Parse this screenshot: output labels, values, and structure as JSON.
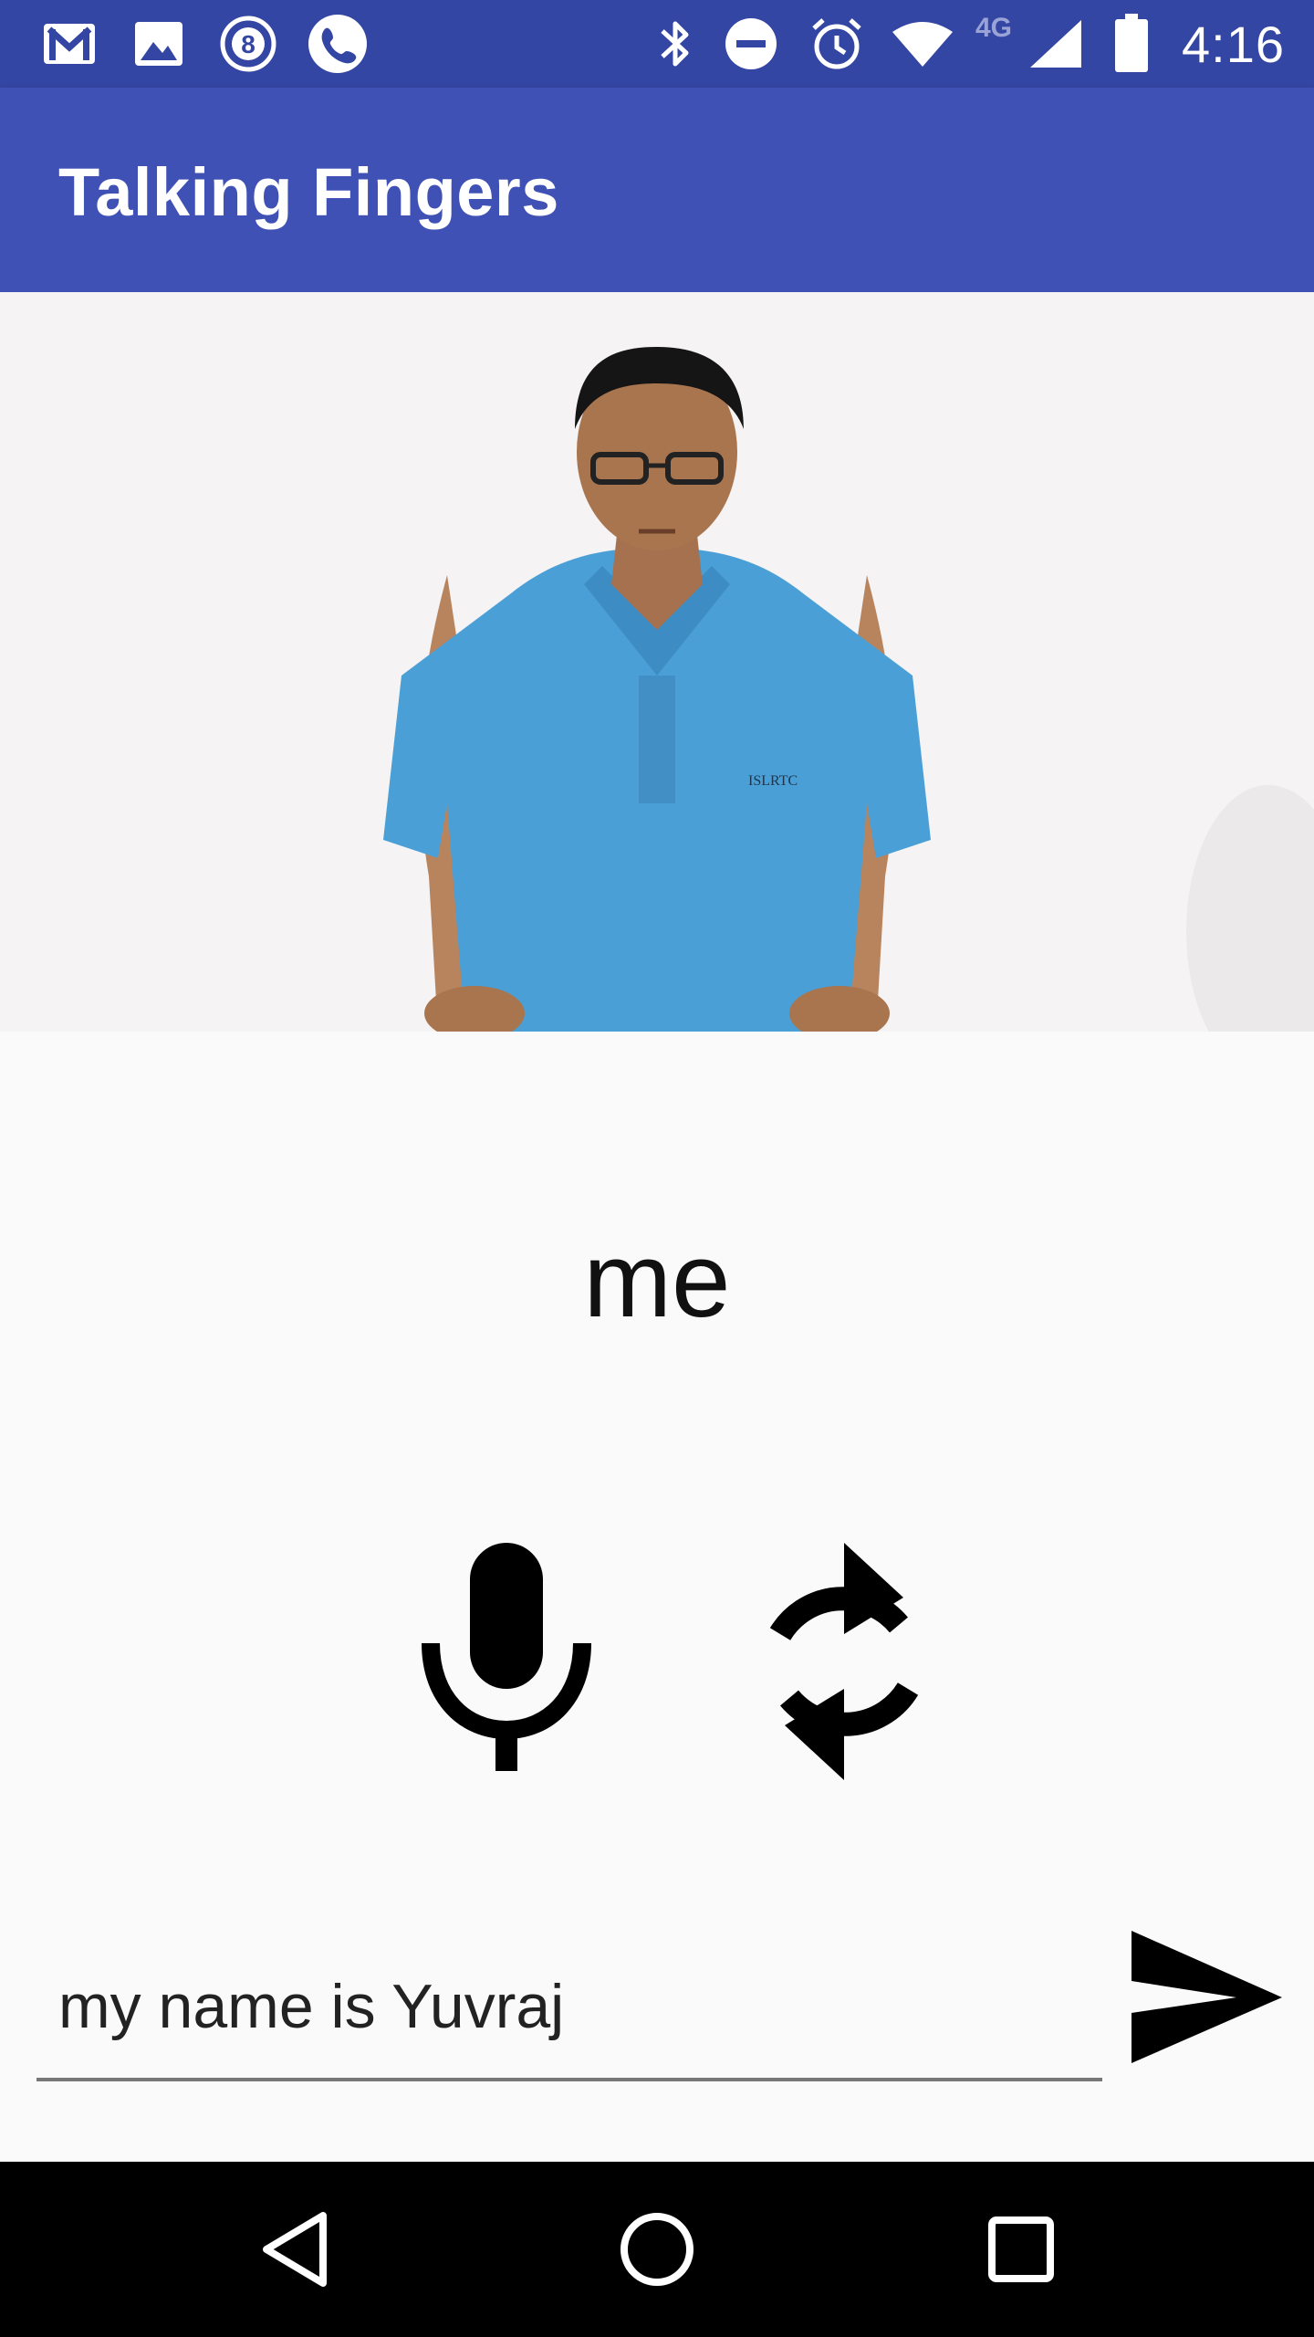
{
  "status_bar": {
    "time": "4:16",
    "network": "4G",
    "battery_level": "78",
    "left_icons": [
      "gmail-icon",
      "image-icon",
      "badge-8-icon",
      "phone-icon"
    ],
    "right_icons": [
      "bluetooth-icon",
      "do-not-disturb-icon",
      "alarm-icon",
      "wifi-icon",
      "signal-icon",
      "battery-icon"
    ]
  },
  "app_bar": {
    "title": "Talking Fingers",
    "color": "#3f51b5",
    "status_color": "#3446a3"
  },
  "video": {
    "shirt_label": "ISLRTC"
  },
  "current_word": "me",
  "controls": {
    "mic_icon": "microphone-icon",
    "refresh_icon": "refresh-icon"
  },
  "input": {
    "value": "my name is Yuvraj"
  },
  "send": {
    "icon": "send-icon"
  },
  "nav_bar": {
    "icons": [
      "back-icon",
      "home-icon",
      "recents-icon"
    ]
  }
}
